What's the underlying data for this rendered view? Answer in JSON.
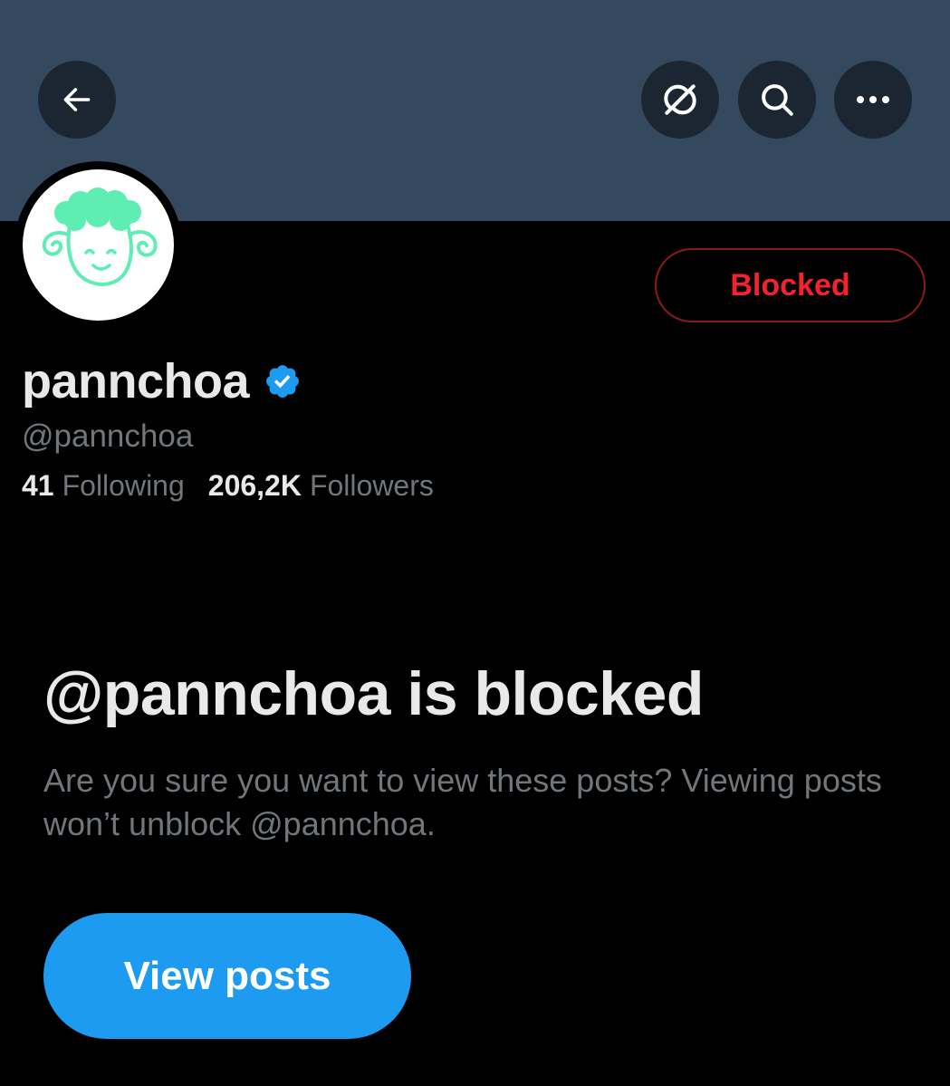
{
  "header": {
    "back_icon": "arrow-left-icon",
    "grok_icon": "grok-icon",
    "search_icon": "search-icon",
    "more_icon": "more-horizontal-icon",
    "banner_color": "#34495e"
  },
  "profile": {
    "display_name": "pannchoa",
    "verified_icon": "verified-badge-icon",
    "handle": "@pannchoa",
    "blocked_button_label": "Blocked",
    "following_count": "41",
    "following_label": "Following",
    "followers_count": "206,2K",
    "followers_label": "Followers"
  },
  "blocked_notice": {
    "title": "@pannchoa is blocked",
    "description": "Are you sure you want to view these posts? Viewing posts won’t unblock @pannchoa.",
    "view_posts_label": "View posts"
  },
  "colors": {
    "accent_blue": "#1d9bf0",
    "blocked_red": "#f4212e",
    "avatar_green": "#5eeeb4"
  }
}
